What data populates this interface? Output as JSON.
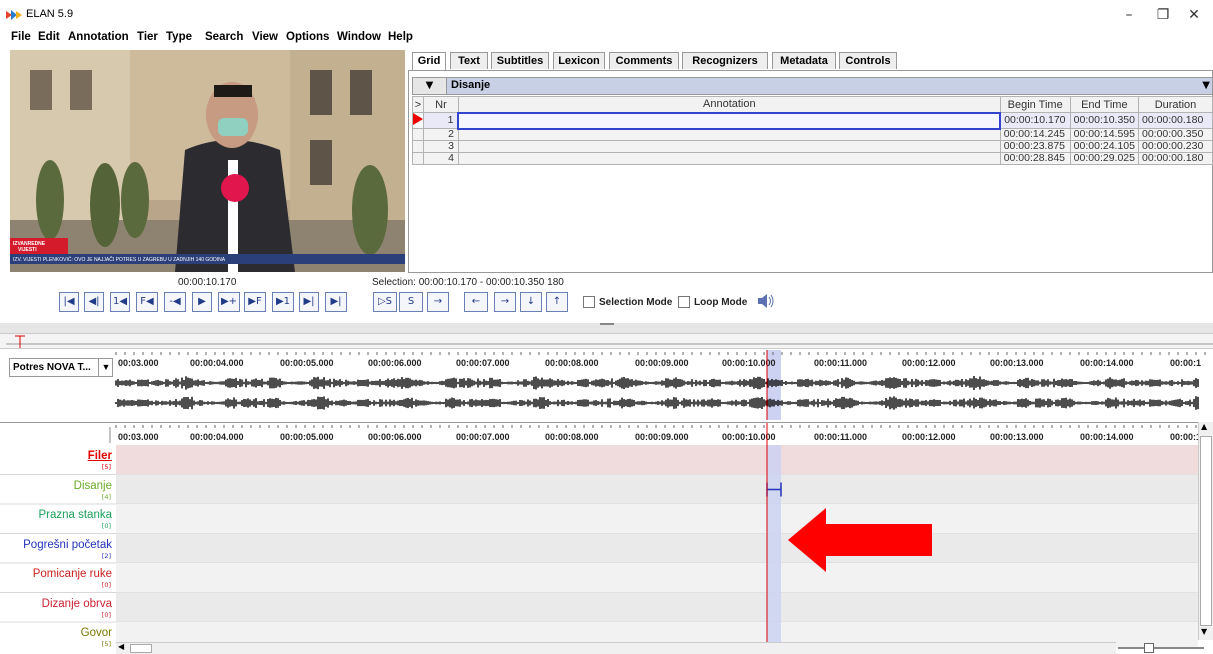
{
  "window": {
    "title": "ELAN 5.9",
    "minimize": "–",
    "restore": "❐",
    "close": "✕"
  },
  "menu": [
    "File",
    "Edit",
    "Annotation",
    "Tier",
    "Type",
    "Search",
    "View",
    "Options",
    "Window",
    "Help"
  ],
  "video": {
    "ticker_badge_line1": "IZVANREDNE",
    "ticker_badge_line2": "VIJESTI",
    "ticker_text": "IZV. VIJESTI   PLENKOVIĆ: OVO JE NAJJAČI POTRES U ZAGREBU U ZADNJIH 140 GODINA"
  },
  "tabs": [
    "Grid",
    "Text",
    "Subtitles",
    "Lexicon",
    "Comments",
    "Recognizers",
    "Metadata",
    "Controls"
  ],
  "active_tab": "Grid",
  "grid": {
    "tier": "Disanje",
    "columns": {
      "marker": ">",
      "nr": "Nr",
      "annotation": "Annotation",
      "begin": "Begin Time",
      "end": "End Time",
      "duration": "Duration"
    },
    "rows": [
      {
        "nr": "1",
        "annotation": "",
        "begin": "00:00:10.170",
        "end": "00:00:10.350",
        "duration": "00:00:00.180"
      },
      {
        "nr": "2",
        "annotation": "",
        "begin": "00:00:14.245",
        "end": "00:00:14.595",
        "duration": "00:00:00.350"
      },
      {
        "nr": "3",
        "annotation": "",
        "begin": "00:00:23.875",
        "end": "00:00:24.105",
        "duration": "00:00:00.230"
      },
      {
        "nr": "4",
        "annotation": "",
        "begin": "00:00:28.845",
        "end": "00:00:29.025",
        "duration": "00:00:00.180"
      }
    ]
  },
  "media_controls": {
    "current_time": "00:00:10.170",
    "selection": "Selection: 00:00:10.170 - 00:00:10.350  180",
    "play_buttons": [
      "|◀",
      "◀|",
      "1◀",
      "F◀",
      "-◀",
      "▶",
      "▶+",
      "▶F",
      "▶1",
      "▶|",
      "▶|"
    ],
    "sel_buttons": [
      "▷S",
      "S",
      "→"
    ],
    "nav_buttons": [
      "←",
      "→",
      "↓",
      "↑"
    ],
    "selection_mode": "Selection Mode",
    "loop_mode": "Loop Mode",
    "volume_icon": "speaker-icon"
  },
  "waveform": {
    "selector": "Potres NOVA T...",
    "ticks": [
      "00:03.000",
      "00:00:04.000",
      "00:00:05.000",
      "00:00:06.000",
      "00:00:07.000",
      "00:00:08.000",
      "00:00:09.000",
      "00:00:10.000",
      "00:00:11.000",
      "00:00:12.000",
      "00:00:13.000",
      "00:00:14.000",
      "00:00:1"
    ]
  },
  "tiers": [
    {
      "name": "Filer",
      "count": "[5]",
      "color": "#e00000"
    },
    {
      "name": "Disanje",
      "count": "[4]",
      "color": "#6aaa2a"
    },
    {
      "name": "Prazna stanka",
      "count": "[0]",
      "color": "#1aa05a"
    },
    {
      "name": "Pogrešni početak",
      "count": "[2]",
      "color": "#2233bb"
    },
    {
      "name": "Pomicanje ruke",
      "count": "[0]",
      "color": "#cc2222"
    },
    {
      "name": "Dizanje obrva",
      "count": "[0]",
      "color": "#cc2233"
    },
    {
      "name": "Govor",
      "count": "[5]",
      "color": "#777700"
    }
  ],
  "colors": {
    "selection": "#cdd2f2",
    "crosshair": "#dd0000",
    "arrow": "#ff0000",
    "filer_row": "#f0dcdc"
  }
}
